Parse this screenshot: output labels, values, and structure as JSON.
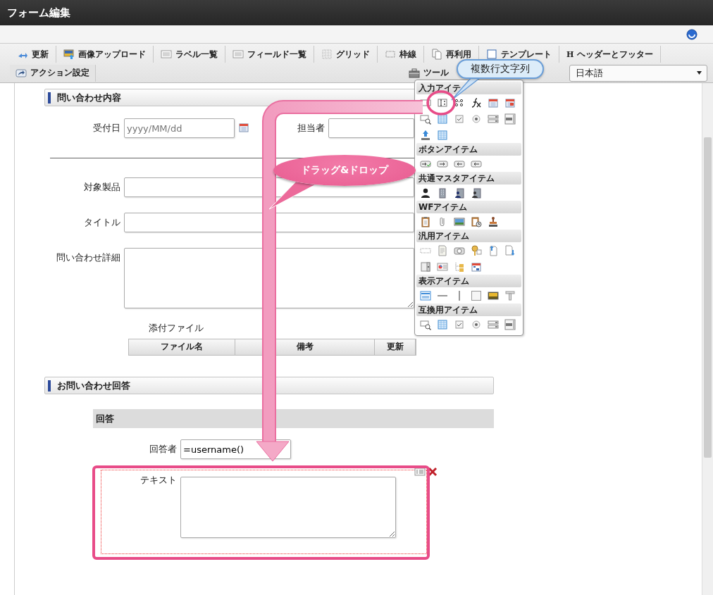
{
  "window": {
    "title": "フォーム編集"
  },
  "toolbar": {
    "tabs": [
      {
        "label": "更新"
      },
      {
        "label": "画像アップロード"
      },
      {
        "label": "ラベル一覧"
      },
      {
        "label": "フィールド一覧"
      },
      {
        "label": "グリッド"
      },
      {
        "label": "枠線"
      },
      {
        "label": "再利用"
      },
      {
        "label": "テンプレート"
      },
      {
        "label": "ヘッダーとフッター",
        "glyph": "H"
      }
    ],
    "actions": [
      {
        "label": "アクション設定"
      }
    ],
    "tools": {
      "label": "ツール"
    },
    "language": {
      "value": "日本語"
    }
  },
  "form": {
    "items": [
      {
        "kind": "section",
        "title": "問い合わせ内容"
      },
      {
        "kind": "date",
        "label": "受付日",
        "placeholder": "yyyy/MM/dd",
        "selected": false
      },
      {
        "kind": "text",
        "label": "担当者",
        "selected": false
      },
      {
        "kind": "rule"
      },
      {
        "kind": "text",
        "label": "対象製品",
        "selected": false
      },
      {
        "kind": "text",
        "label": "タイトル",
        "selected": false
      },
      {
        "kind": "textarea",
        "label": "問い合わせ詳細",
        "selected": false
      },
      {
        "kind": "table",
        "label": "添付ファイル",
        "columns": [
          "ファイル名",
          "備考",
          "更新"
        ]
      },
      {
        "kind": "section",
        "title": "お問い合わせ回答"
      },
      {
        "kind": "subsection",
        "title": "回答"
      },
      {
        "kind": "text",
        "label": "回答者",
        "value": "=username()",
        "selected": false
      },
      {
        "kind": "textarea",
        "label": "テキスト",
        "selected": true
      }
    ]
  },
  "palette": {
    "sections": [
      {
        "title": "入力アイテ"
      },
      {
        "title": "ボタンアイテム"
      },
      {
        "title": "共通マスタアイテム"
      },
      {
        "title": "WFアイテム"
      },
      {
        "title": "汎用アイテム"
      },
      {
        "title": "表示アイテム"
      },
      {
        "title": "互換用アイテム"
      }
    ]
  },
  "annotations": [
    {
      "kind": "drag-arrow"
    },
    {
      "kind": "drag-label",
      "text": "ドラッグ&ドロップ"
    },
    {
      "kind": "tooltip",
      "text": "複数行文字列"
    },
    {
      "kind": "highlight-circle"
    },
    {
      "kind": "highlight-frame"
    }
  ]
}
